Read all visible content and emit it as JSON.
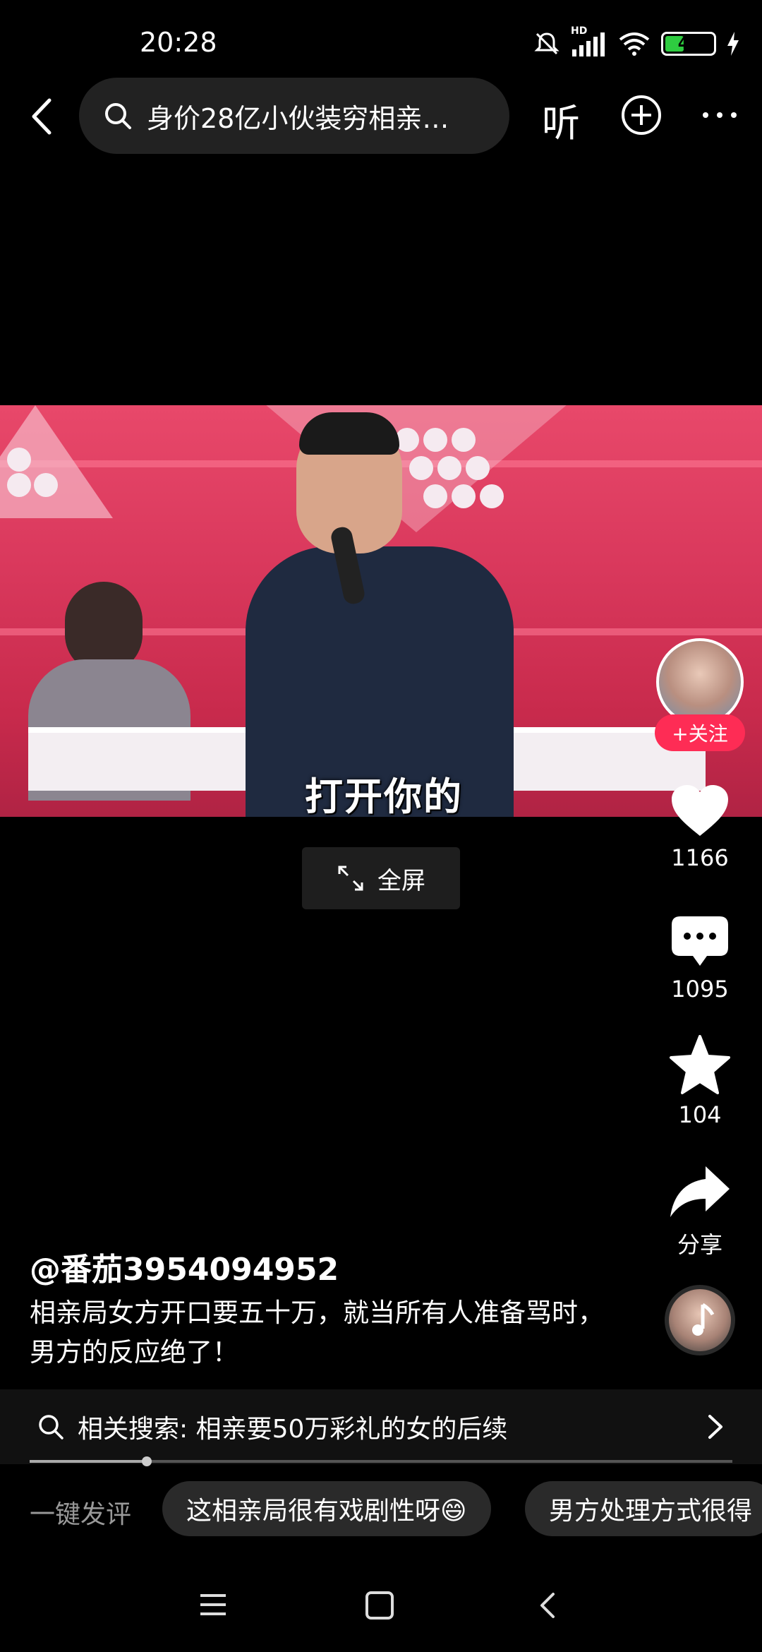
{
  "status_bar": {
    "time": "20:28",
    "battery": "44",
    "battery_level_percent": 44,
    "network_label": "HD",
    "icons": [
      "mute-icon",
      "signal-icon",
      "wifi-icon",
      "battery-icon",
      "charging-icon"
    ]
  },
  "top_bar": {
    "search_text": "身价28亿小伙装穷相亲…",
    "listen_label": "听",
    "icons": [
      "back-arrow-icon",
      "search-icon",
      "plus-circle-icon",
      "more-icon"
    ]
  },
  "video": {
    "subtitle": "打开你的"
  },
  "fullscreen_button": {
    "label": "全屏"
  },
  "right_rail": {
    "follow_label": "+关注",
    "likes": "1166",
    "comments": "1095",
    "favorites": "104",
    "share_label": "分享"
  },
  "post": {
    "author": "@番茄3954094952",
    "description": "相亲局女方开口要五十万，就当所有人准备骂时，男方的反应绝了！"
  },
  "related_search": {
    "label": "相关搜索: 相亲要50万彩礼的女的后续"
  },
  "progress": {
    "fraction": 0.167
  },
  "quick_comments": {
    "label": "一键发评",
    "chips": [
      "这相亲局很有戏剧性呀😄",
      "男方处理方式很得"
    ]
  },
  "colors": {
    "accent": "#fe2c55",
    "background": "#000000"
  }
}
